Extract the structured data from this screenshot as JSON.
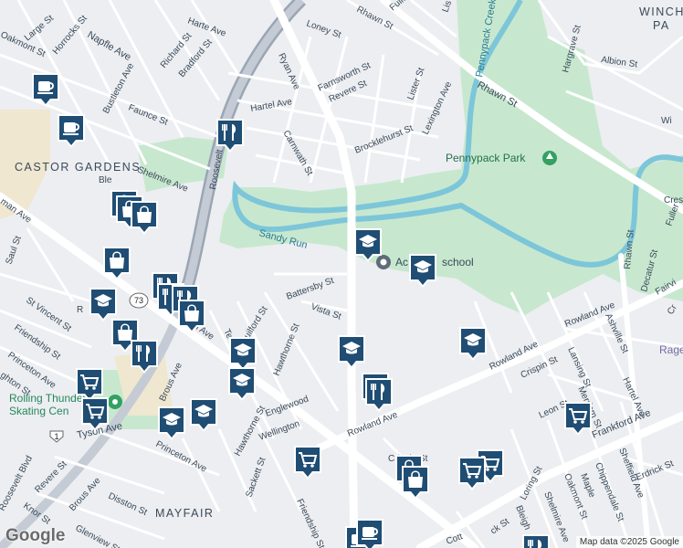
{
  "map": {
    "neighborhoods": {
      "castor_gardens": "CASTOR GARDENS",
      "mayfair": "MAYFAIR",
      "winch": "WINCH",
      "pa": "PA"
    },
    "parks": {
      "pennypack_park": "Pennypack Park",
      "rolling_thunder": "Rolling Thunder",
      "skating_center": "Skating Cen"
    },
    "water": {
      "pennypack_creek": "Pennypack Creek",
      "sandy_run": "Sandy Run"
    },
    "poi": {
      "school": "Ac",
      "school_rest": "school",
      "rage": "Rage"
    },
    "highways": {
      "route_73": "73",
      "route_1": "1"
    },
    "streets": {
      "harte_ave": "Harte Ave",
      "loney_st": "Loney St",
      "rhawn_st_top": "Rhawn St",
      "fuller_st_top": "Fuller St",
      "lis": "Lis",
      "large_st": "Large St",
      "oakmont_st": "Oakmont St",
      "horrocks_st": "Horrocks St",
      "napfle_ave": "Napfle Ave",
      "richard_st": "Richard St",
      "bradford_st": "Bradford St",
      "ryan_ave": "Ryan Ave",
      "farnsworth_st": "Farnsworth St",
      "hargrave_st": "Hargrave St",
      "albion_st": "Albion St",
      "bustleton_ave": "Bustleton Ave",
      "rhawn_st": "Rhawn St",
      "revere_st_top": "Revere St",
      "lister_st": "Lister St",
      "hartel_ave_top": "Hartel Ave",
      "lexington_ave": "Lexington Ave",
      "faunce_st": "Faunce St",
      "roosevelt": "Roosevelt",
      "carnwath_st": "Carnwath St",
      "brocklehurst_st": "Brocklehurst St",
      "shelmire_ave_top": "Shelmire Ave",
      "ble": "Ble",
      "roosevelt_blvd_v": "Roosevelt",
      "wi": "Wi",
      "cresc": "Cresc",
      "fuller": "Fuller",
      "rhawn_st_right": "Rhawn St",
      "saul_st": "Saul St",
      "battersby_st": "Battersby St",
      "vista_st": "Vista St",
      "fairvi": "Fairvi",
      "cr": "Cr",
      "st_vincent_st": "St Vincent St",
      "friendship_st_left": "Friendship St",
      "princeton_ave_left": "Princeton Ave",
      "ghton_st": "ghton St",
      "guilford_st": "Guilford St",
      "hawthorne_st_top": "Hawthorne St",
      "rowland_ave_right": "Rowland Ave",
      "rowland_ave_diag": "Rowland Ave",
      "ashville_st": "Ashville St",
      "decatur_st": "Decatur St",
      "lansing_st": "Lansing St",
      "hartel_ave_right": "Hartel Ave",
      "crispin_st": "Crispin St",
      "brous_ave": "Brous Ave",
      "merriam_st": "Merriam St",
      "leon_st": "Leon St",
      "rowland_ave": "Rowland Ave",
      "hawthorne_st_low": "Hawthorne St",
      "englewood": "Englewood",
      "wellington": "Wellington",
      "frankford_ave": "Frankford Ave",
      "tyson_ave": "Tyson Ave",
      "princeton_ave": "Princeton Ave",
      "crispin_st_low": "Crispin St",
      "sheffield_ave": "Sheffield Ave",
      "erdrick_st": "Erdrick St",
      "roosevelt_blvd": "Roosevelt Blvd",
      "revere_st": "Revere St",
      "brous_ave_low": "Brous Ave",
      "disston_st": "Disston St",
      "sackett_st": "Sackett St",
      "friendship_st": "Friendship St",
      "knor_st": "Knor St",
      "glenview_st": "Glenview St",
      "chippendale_st": "Chippendale St",
      "oakmont_st_low": "Oakmont St",
      "maple": "Maple",
      "shelmire_ave": "Shelmire Ave",
      "loring_st": "Loring St",
      "bleigh": "Bleigh",
      "ck_st": "ck St",
      "te": "Te",
      "cottman": "Cott",
      "rt": "R",
      "man_ave": "man Ave",
      "man_ave_left": "man Ave"
    },
    "attribution": "Map data ©2025 Google",
    "logo": "Google"
  }
}
